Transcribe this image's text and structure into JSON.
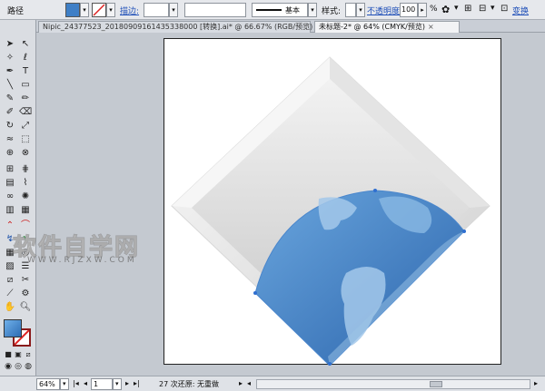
{
  "control_bar": {
    "path_label": "路径",
    "stroke_label": "描边:",
    "stroke_profile": "基本",
    "style_label": "样式:",
    "opacity_label": "不透明度:",
    "opacity_value": "100",
    "opacity_unit": "%",
    "transform_label": "变换",
    "fill_color": "#3f7fc6"
  },
  "tabs": [
    {
      "label": "Nipic_24377523_20180909161435338000 [转换].ai* @ 66.67% (RGB/预览)"
    },
    {
      "label": "未标题-2* @ 64% (CMYK/预览)"
    }
  ],
  "tab_close_glyph": "×",
  "status_bar": {
    "zoom": "64%",
    "page": "1",
    "status_text": "27 次还原: 无重做"
  },
  "watermark": {
    "main": "软件自学网",
    "sub": "WWW.RJZXW.COM"
  },
  "artwork": {
    "frame_light": "#f3f3f3",
    "frame_mid": "#d2d2d2",
    "inner_gray": "#e0e0e0",
    "globe_dark": "#2f6fb6",
    "globe_light": "#6aa6de",
    "land_color": "#9cc3e6"
  }
}
